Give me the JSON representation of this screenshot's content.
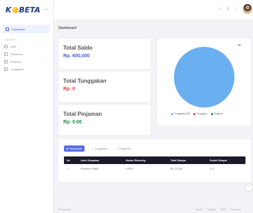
{
  "brand": {
    "logo_k": "K",
    "logo_rest": "BETA",
    "toggle_icon": "minus-icon"
  },
  "sidebar": {
    "items": [
      {
        "label": "Dashboard",
        "icon": "grid-icon",
        "active": true
      },
      {
        "section": "MASTER"
      },
      {
        "label": "Data",
        "icon": "folder-icon",
        "chevron": "›"
      },
      {
        "label": "Simpanan",
        "icon": "wallet-icon"
      },
      {
        "label": "Pinjaman",
        "icon": "money-icon",
        "chevron": "›"
      },
      {
        "label": "Tunggakan",
        "icon": "clock-icon"
      }
    ]
  },
  "topbar": {
    "search_icon": "search-icon",
    "bell_icon": "bell-icon",
    "heart_icon": "heart-icon"
  },
  "page": {
    "title": "Dashboard"
  },
  "cards": [
    {
      "title": "Total Saldo",
      "value": "Rp. 600,000",
      "color": "#4a5bd6"
    },
    {
      "title": "Total Tunggakan",
      "value": "Rp. 0",
      "color": "#e23b3b"
    },
    {
      "title": "Total Pinjaman",
      "value": "Rp. 0.00",
      "color": "#1e8a3a"
    }
  ],
  "chart_data": {
    "type": "pie",
    "categories": [
      "Tunggakan Aktif",
      "Tunggakan",
      "Pinjaman"
    ],
    "values": [
      100,
      0,
      0
    ],
    "colors": [
      "#6aaff0",
      "#e23b3b",
      "#1e8a3a"
    ],
    "legend_position": "bottom",
    "menu_icon": "hamburger-icon"
  },
  "table": {
    "tabs": [
      {
        "label": "Simpanan",
        "active": true
      },
      {
        "label": "Tunggakan",
        "active": false
      },
      {
        "label": "Pinjaman",
        "active": false
      }
    ],
    "headers": [
      "No",
      "Jenis Simpanan",
      "Nomor Rekening",
      "Total Dibayar",
      "Sudah Dibayar"
    ],
    "rows": [
      [
        "1",
        "Simpanan Wajib",
        "# 0011",
        "Rp. 10,000",
        "11.1"
      ]
    ]
  },
  "footer": {
    "copyright": "© Koperasi",
    "links": [
      "About",
      "Support",
      "FAQ",
      "Purchase"
    ]
  },
  "fab_icon": "arrow-up-icon"
}
